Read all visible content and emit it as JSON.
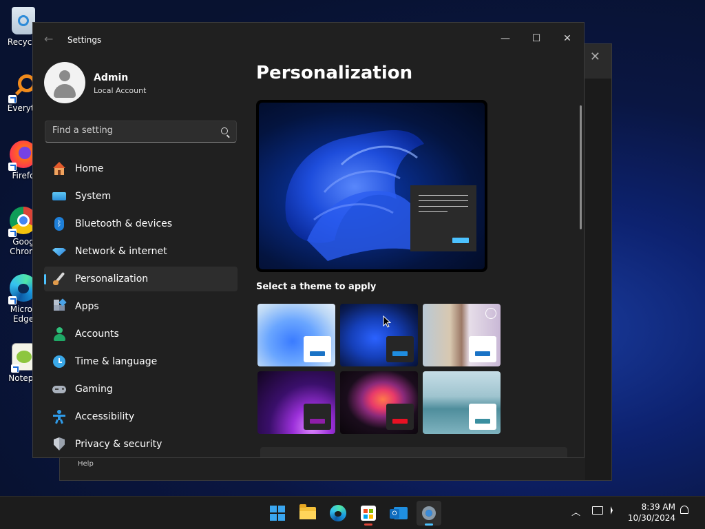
{
  "desktop": {
    "icons": [
      {
        "label": "Recycle"
      },
      {
        "label": "Everyth"
      },
      {
        "label": "Firefo"
      },
      {
        "label": "Goog\nChrom"
      },
      {
        "label": "Micros\nEdge"
      },
      {
        "label": "Notepa"
      }
    ]
  },
  "background_window": {
    "help_label": "Help"
  },
  "window": {
    "title": "Settings",
    "controls": {
      "minimize": "—",
      "maximize": "☐",
      "close": "✕"
    }
  },
  "profile": {
    "name": "Admin",
    "account_type": "Local Account"
  },
  "search": {
    "placeholder": "Find a setting"
  },
  "nav": {
    "items": [
      {
        "label": "Home",
        "icon": "home-icon"
      },
      {
        "label": "System",
        "icon": "system-icon"
      },
      {
        "label": "Bluetooth & devices",
        "icon": "bluetooth-icon"
      },
      {
        "label": "Network & internet",
        "icon": "network-icon"
      },
      {
        "label": "Personalization",
        "icon": "brush-icon",
        "active": true
      },
      {
        "label": "Apps",
        "icon": "apps-icon"
      },
      {
        "label": "Accounts",
        "icon": "accounts-icon"
      },
      {
        "label": "Time & language",
        "icon": "time-icon"
      },
      {
        "label": "Gaming",
        "icon": "gaming-icon"
      },
      {
        "label": "Accessibility",
        "icon": "accessibility-icon"
      },
      {
        "label": "Privacy & security",
        "icon": "shield-icon"
      }
    ]
  },
  "page": {
    "title": "Personalization",
    "theme_section_label": "Select a theme to apply",
    "themes": [
      {
        "name": "windows-light"
      },
      {
        "name": "windows-dark"
      },
      {
        "name": "spotlight"
      },
      {
        "name": "glow"
      },
      {
        "name": "captured-motion"
      },
      {
        "name": "flow"
      }
    ]
  },
  "taskbar": {
    "apps": [
      "start",
      "file-explorer",
      "edge",
      "store",
      "outlook-new",
      "settings"
    ],
    "time": "8:39 AM",
    "date": "10/30/2024"
  },
  "colors": {
    "accent": "#4cc2ff",
    "window_bg": "#202020"
  }
}
